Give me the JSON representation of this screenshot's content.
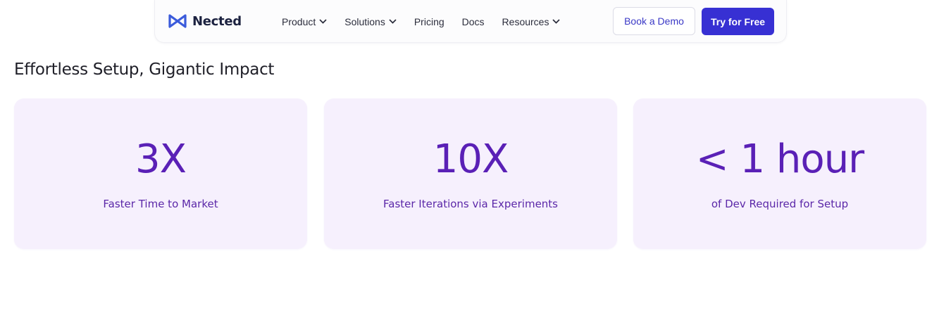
{
  "brand": {
    "name": "Nected",
    "logo_color": "#3b5bdb"
  },
  "nav": {
    "items": [
      {
        "label": "Product",
        "has_dropdown": true
      },
      {
        "label": "Solutions",
        "has_dropdown": true
      },
      {
        "label": "Pricing",
        "has_dropdown": false
      },
      {
        "label": "Docs",
        "has_dropdown": false
      },
      {
        "label": "Resources",
        "has_dropdown": true
      }
    ],
    "demo_button": "Book a Demo",
    "try_button": "Try for Free"
  },
  "section": {
    "title": "Effortless Setup, Gigantic Impact"
  },
  "stats": [
    {
      "value": "3X",
      "label": "Faster Time to Market"
    },
    {
      "value": "10X",
      "label": "Faster Iterations via Experiments"
    },
    {
      "value": "< 1 hour",
      "label": "of Dev Required for Setup"
    }
  ],
  "colors": {
    "primary_button": "#3730d3",
    "card_background": "#f6f0fd",
    "stat_text": "#5a20b6"
  }
}
